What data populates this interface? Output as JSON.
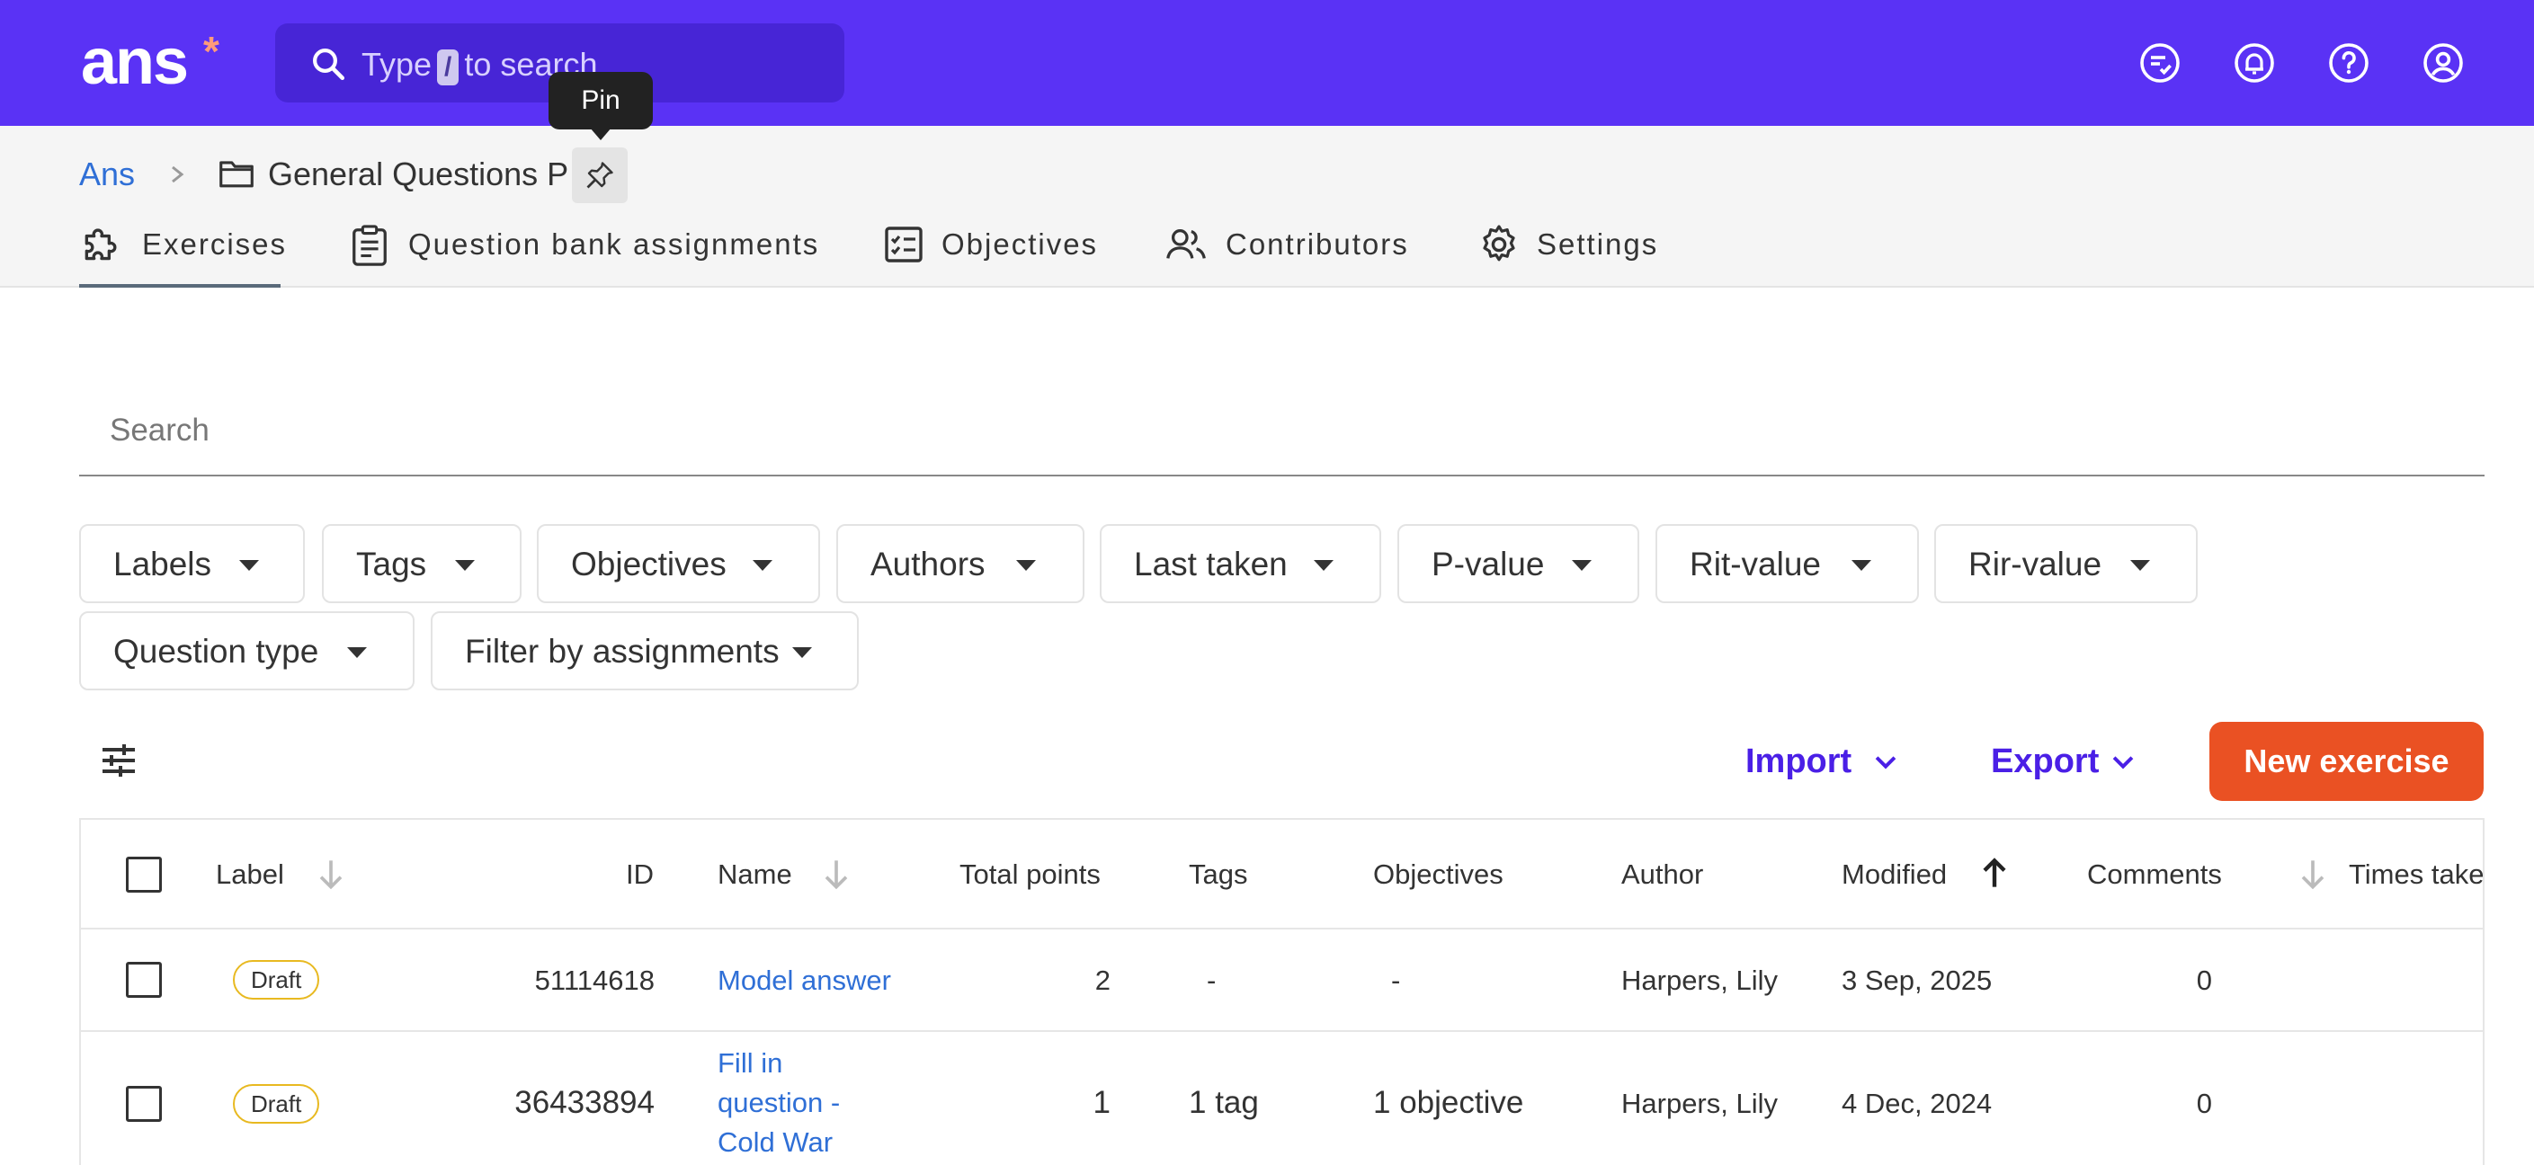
{
  "app": {
    "logo_text": "ans",
    "logo_star": "*",
    "brand_color": "#5a32f5",
    "accent_color": "#ea5123"
  },
  "topbar": {
    "search_prefix": "Type",
    "search_key": "/",
    "search_suffix": "to search",
    "icons": [
      "tasks-check-icon",
      "bell-icon",
      "help-icon",
      "user-icon"
    ]
  },
  "tooltip": {
    "text": "Pin"
  },
  "breadcrumb": {
    "home": "Ans",
    "separator": ">",
    "current": "General Questions P"
  },
  "tabs": [
    {
      "label": "Exercises",
      "icon": "puzzle-icon",
      "active": true
    },
    {
      "label": "Question bank assignments",
      "icon": "clipboard-icon",
      "active": false
    },
    {
      "label": "Objectives",
      "icon": "checklist-icon",
      "active": false
    },
    {
      "label": "Contributors",
      "icon": "people-icon",
      "active": false
    },
    {
      "label": "Settings",
      "icon": "gear-icon",
      "active": false
    }
  ],
  "search": {
    "placeholder": "Search",
    "value": ""
  },
  "filters": [
    "Labels",
    "Tags",
    "Objectives",
    "Authors",
    "Last taken",
    "P-value",
    "Rit-value",
    "Rir-value",
    "Question type",
    "Filter by assignments"
  ],
  "actions": {
    "import_label": "Import",
    "export_label": "Export",
    "new_label": "New exercise"
  },
  "table": {
    "columns": [
      "Label",
      "ID",
      "Name",
      "Total points",
      "Tags",
      "Objectives",
      "Author",
      "Modified",
      "Comments",
      "Times take"
    ],
    "sorted_column": "Modified",
    "sort_direction": "ascending",
    "rows": [
      {
        "label": "Draft",
        "id": "51114618",
        "name": [
          "Model answer"
        ],
        "total_points": "2",
        "tags": "-",
        "objectives": "-",
        "author": "Harpers, Lily",
        "modified": "3 Sep, 2025",
        "comments": "0"
      },
      {
        "label": "Draft",
        "id": "36433894",
        "name": [
          "Fill in",
          "question -",
          "Cold War"
        ],
        "total_points": "1",
        "tags": "1 tag",
        "objectives": "1 objective",
        "author": "Harpers, Lily",
        "modified": "4 Dec, 2024",
        "comments": "0"
      }
    ]
  }
}
